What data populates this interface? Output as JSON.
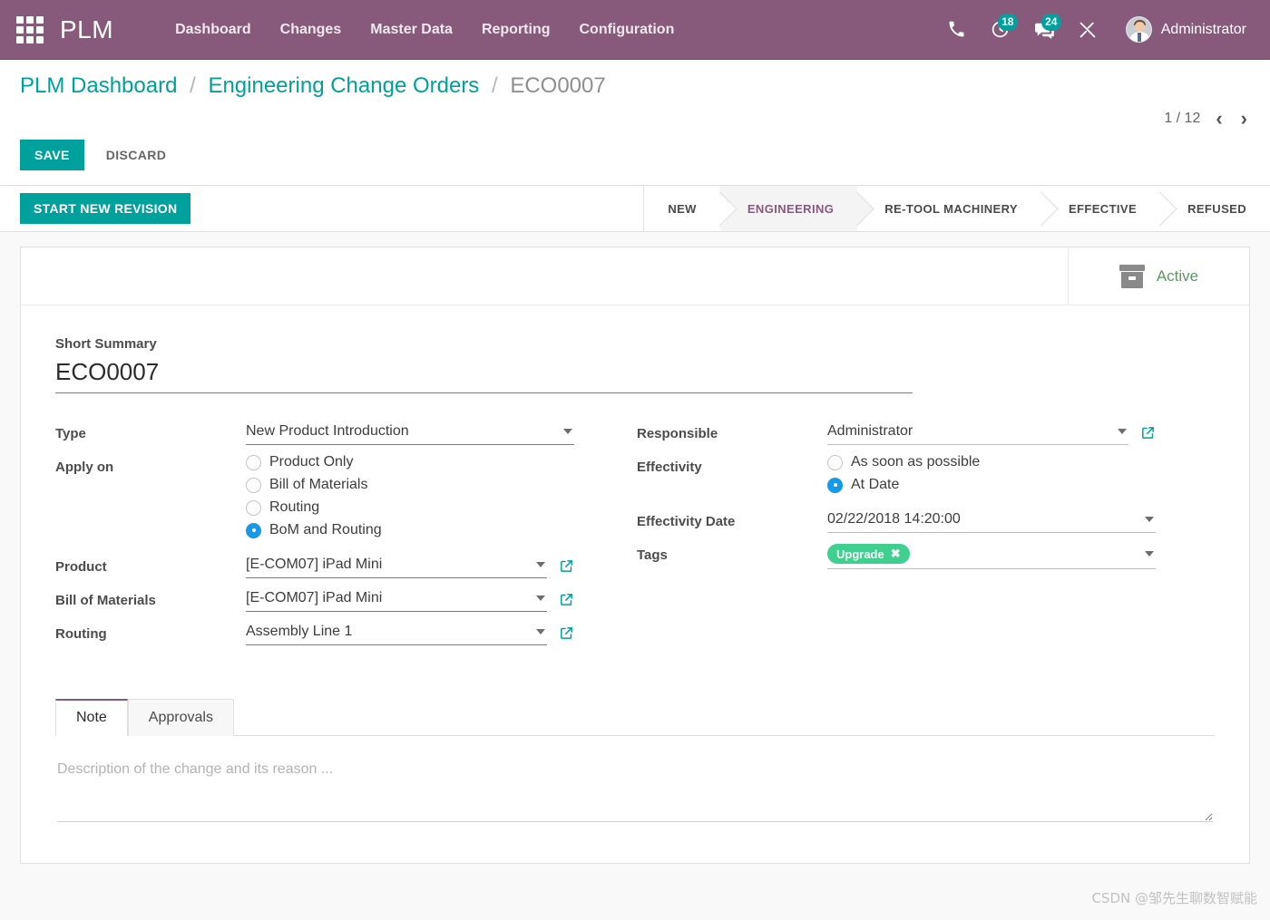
{
  "navbar": {
    "apps_icon": "apps-grid-icon",
    "brand": "PLM",
    "menus": [
      {
        "label": "Dashboard"
      },
      {
        "label": "Changes"
      },
      {
        "label": "Master Data"
      },
      {
        "label": "Reporting"
      },
      {
        "label": "Configuration"
      }
    ],
    "icons": {
      "phone": "phone-icon",
      "activity": "clock-activity-icon",
      "messaging": "chat-messages-icon",
      "tools": "tools-wrench-icon"
    },
    "activity_count": "18",
    "messages_count": "24",
    "user_name": "Administrator",
    "brand_color": "#875A7B",
    "badge_color": "#00A09D"
  },
  "control_panel": {
    "breadcrumb": [
      {
        "label": "PLM Dashboard",
        "current": false
      },
      {
        "label": "Engineering Change Orders",
        "current": false
      },
      {
        "label": "ECO0007",
        "current": true
      }
    ],
    "separator": "/",
    "save_label": "SAVE",
    "discard_label": "DISCARD",
    "pager_text": "1 / 12",
    "pager_prev": "‹",
    "pager_next": "›",
    "save_color": "#00A09D"
  },
  "action_bar": {
    "new_revision_label": "START NEW REVISION",
    "statuses": [
      {
        "label": "NEW",
        "active": false
      },
      {
        "label": "ENGINEERING",
        "active": true
      },
      {
        "label": "RE-TOOL MACHINERY",
        "active": false
      },
      {
        "label": "EFFECTIVE",
        "active": false
      },
      {
        "label": "REFUSED",
        "active": false
      }
    ],
    "active_color": "#875A7B"
  },
  "stat_button": {
    "icon": "archive-box-icon",
    "label": "Active",
    "color": "#5b9a5e"
  },
  "form": {
    "title": {
      "label": "Short Summary",
      "value": "ECO0007"
    },
    "left": {
      "type": {
        "label": "Type",
        "value": "New Product Introduction"
      },
      "apply_on": {
        "label": "Apply on",
        "options": [
          {
            "label": "Product Only",
            "selected": false
          },
          {
            "label": "Bill of Materials",
            "selected": false
          },
          {
            "label": "Routing",
            "selected": false
          },
          {
            "label": "BoM and Routing",
            "selected": true
          }
        ]
      },
      "product": {
        "label": "Product",
        "value": "[E-COM07] iPad Mini"
      },
      "bill_of_materials": {
        "label": "Bill of Materials",
        "value": "[E-COM07] iPad Mini"
      },
      "routing": {
        "label": "Routing",
        "value": "Assembly Line 1"
      }
    },
    "right": {
      "responsible": {
        "label": "Responsible",
        "value": "Administrator"
      },
      "effectivity": {
        "label": "Effectivity",
        "options": [
          {
            "label": "As soon as possible",
            "selected": false
          },
          {
            "label": "At Date",
            "selected": true
          }
        ]
      },
      "effectivity_date": {
        "label": "Effectivity Date",
        "value": "02/22/2018 14:20:00"
      },
      "tags": {
        "label": "Tags",
        "chips": [
          {
            "label": "Upgrade",
            "remove": "✖",
            "color": "#3fcf8e"
          }
        ]
      }
    }
  },
  "notebook": {
    "tabs": [
      {
        "label": "Note",
        "active": true
      },
      {
        "label": "Approvals",
        "active": false
      }
    ],
    "note_placeholder": "Description of the change and its reason ...",
    "note_value": ""
  },
  "watermark": "CSDN @邹先生聊数智赋能"
}
